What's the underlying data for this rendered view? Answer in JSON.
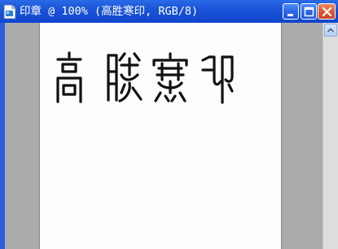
{
  "window": {
    "title": "印章 @ 100% (高胜寒印, RGB/8)"
  },
  "colors": {
    "titlebar": "#1a54d8",
    "close_button": "#e05a33",
    "canvas": "#fdfdfd",
    "workspace": "#ababab",
    "ink": "#111111"
  },
  "icons": {
    "document": "document-icon",
    "minimize": "minimize-icon",
    "maximize": "maximize-icon",
    "close": "close-icon",
    "scroll_up": "arrow-up-icon"
  },
  "canvas": {
    "seal_characters": [
      "高",
      "胜",
      "寒",
      "印"
    ]
  }
}
